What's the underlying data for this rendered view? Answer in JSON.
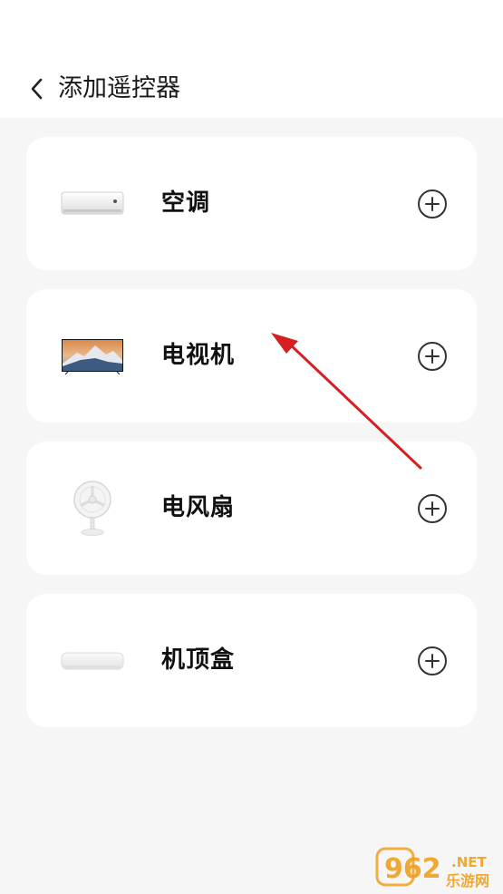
{
  "header": {
    "title": "添加遥控器",
    "back_icon": "chevron-left-icon"
  },
  "devices": [
    {
      "label": "空调",
      "image": "air-conditioner"
    },
    {
      "label": "电视机",
      "image": "television"
    },
    {
      "label": "电风扇",
      "image": "electric-fan"
    },
    {
      "label": "机顶盒",
      "image": "set-top-box"
    }
  ],
  "add_icon": "plus-circle-icon",
  "watermark": {
    "number": "962",
    "suffix": ".NET",
    "text": "乐游网"
  },
  "colors": {
    "background": "#f6f6f6",
    "card": "#ffffff",
    "annotation_arrow": "#d42020",
    "watermark": "#f0a020"
  }
}
